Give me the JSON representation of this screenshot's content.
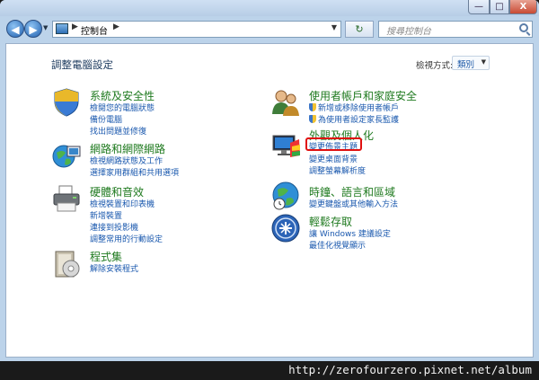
{
  "window": {
    "minimize_label": "—",
    "maximize_label": "□",
    "close_label": "X"
  },
  "nav": {
    "back_glyph": "◀",
    "forward_glyph": "▶",
    "address": "控制台",
    "address_sep": "▶",
    "refresh_glyph": "↻",
    "search_placeholder": "搜尋控制台"
  },
  "main": {
    "title": "調整電腦設定",
    "viewby_label": "檢視方式:",
    "viewby_value": "類別"
  },
  "categories": [
    {
      "title": "系統及安全性",
      "icon": "security-shield-icon",
      "links": [
        "檢閱您的電腦狀態",
        "備份電腦",
        "找出問題並修復"
      ]
    },
    {
      "title": "網路和網際網路",
      "icon": "network-globe-icon",
      "links": [
        "檢視網路狀態及工作",
        "選擇家用群組和共用選項"
      ]
    },
    {
      "title": "硬體和音效",
      "icon": "printer-icon",
      "links": [
        "檢視裝置和印表機",
        "新增裝置",
        "連接到投影機",
        "調整常用的行動設定"
      ]
    },
    {
      "title": "程式集",
      "icon": "programs-icon",
      "links": [
        "解除安裝程式"
      ]
    },
    {
      "title": "使用者帳戶和家庭安全",
      "icon": "users-icon",
      "links": [
        "新增或移除使用者帳戶",
        "為使用者設定家長監護"
      ]
    },
    {
      "title": "外觀及個人化",
      "icon": "display-icon",
      "links": [
        "變更佈景主題",
        "變更桌面背景",
        "調整螢幕解析度"
      ]
    },
    {
      "title": "時鐘、語言和區域",
      "icon": "clock-globe-icon",
      "links": [
        "變更鍵盤或其他輸入方法"
      ]
    },
    {
      "title": "輕鬆存取",
      "icon": "ease-of-access-icon",
      "links": [
        "讓 Windows 建議設定",
        "最佳化視覺顯示"
      ]
    }
  ],
  "watermark": "http://zerofourzero.pixnet.net/album",
  "colors": {
    "category_title": "#1f7a1f",
    "link": "#1a58ae",
    "highlight_box": "#e01010"
  }
}
